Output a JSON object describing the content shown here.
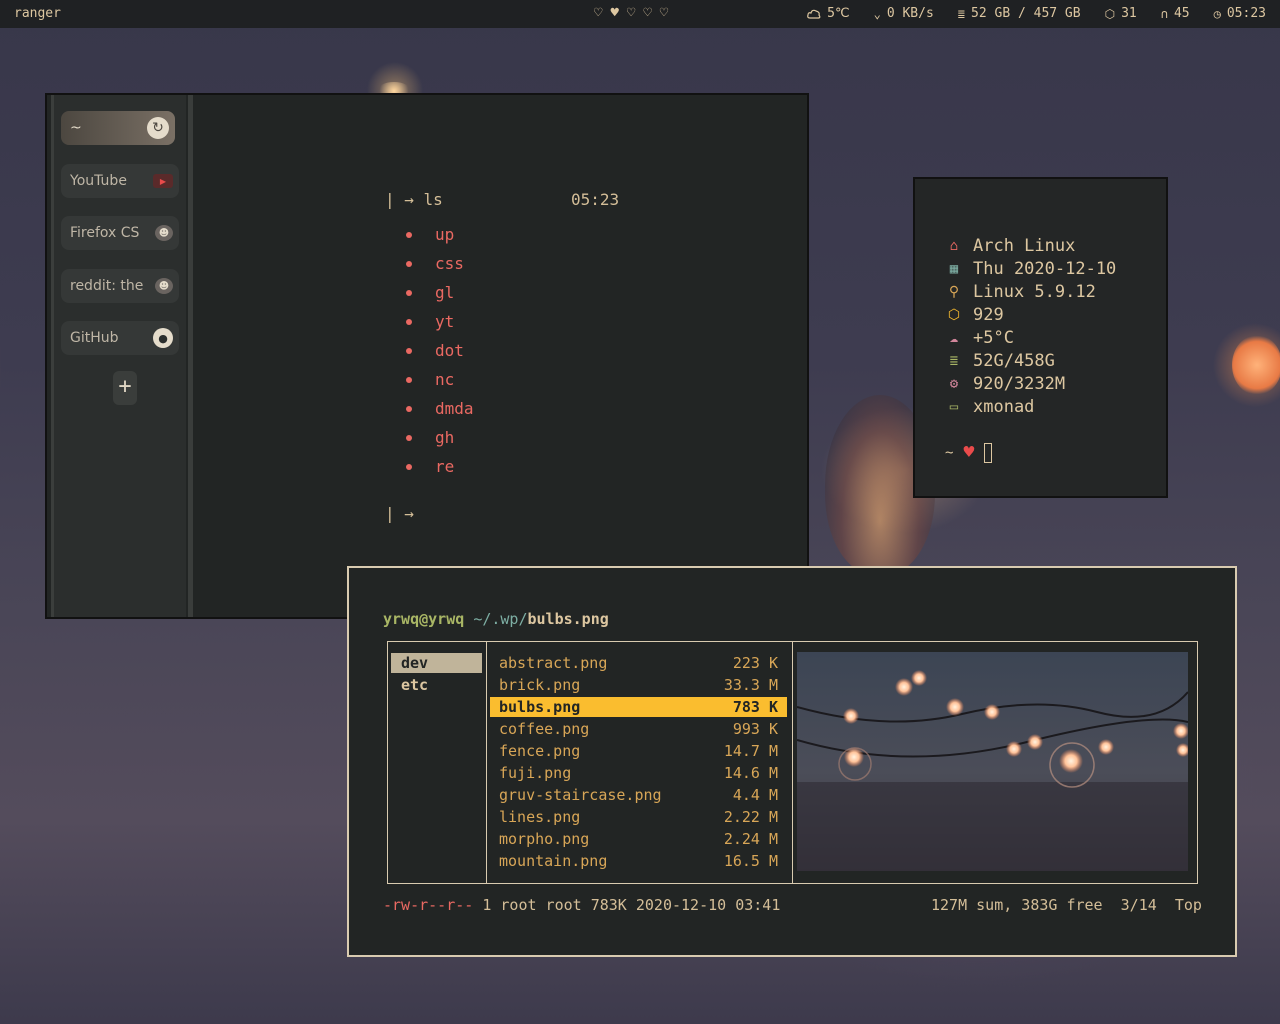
{
  "topbar": {
    "title": "ranger",
    "hearts": [
      "♡",
      "♥",
      "♡",
      "♡",
      "♡"
    ],
    "weather": "5℃",
    "net": "0 KB/s",
    "disk": "52 GB / 457 GB",
    "packages": "31",
    "volume": "45",
    "clock": "05:23"
  },
  "browser": {
    "tabs": [
      {
        "label": "~",
        "icon": "firefox-icon"
      },
      {
        "label": "YouTube",
        "icon": "youtube-icon"
      },
      {
        "label": "Firefox CS",
        "icon": "reddit-icon"
      },
      {
        "label": "reddit: the",
        "icon": "reddit-icon"
      },
      {
        "label": "GitHub",
        "icon": "github-icon"
      }
    ],
    "new_tab": "+",
    "prompt_cmd": "| → ls",
    "prompt_time": "05:23",
    "links": [
      "up",
      "css",
      "gl",
      "yt",
      "dot",
      "nc",
      "dmda",
      "gh",
      "re"
    ],
    "prompt_end": "| →"
  },
  "fetch": {
    "os": "Arch Linux",
    "date": "Thu 2020-12-10",
    "kernel": "Linux 5.9.12",
    "packages": "929",
    "temp": "+5°C",
    "disk": "52G/458G",
    "memory": "920/3232M",
    "wm": "xmonad",
    "prompt": "~"
  },
  "ranger": {
    "user": "yrwq@yrwq",
    "path": "~/.wp/",
    "file": "bulbs.png",
    "parent_dirs": [
      "dev",
      "etc"
    ],
    "files": [
      {
        "name": "abstract.png",
        "size": "223 K"
      },
      {
        "name": "brick.png",
        "size": "33.3 M"
      },
      {
        "name": "bulbs.png",
        "size": "783 K"
      },
      {
        "name": "coffee.png",
        "size": "993 K"
      },
      {
        "name": "fence.png",
        "size": "14.7 M"
      },
      {
        "name": "fuji.png",
        "size": "14.6 M"
      },
      {
        "name": "gruv-staircase.png",
        "size": "4.4 M"
      },
      {
        "name": "lines.png",
        "size": "2.22 M"
      },
      {
        "name": "morpho.png",
        "size": "2.24 M"
      },
      {
        "name": "mountain.png",
        "size": "16.5 M"
      }
    ],
    "selected_index": 2,
    "perms": "-rw-r--r--",
    "info": "1 root root 783K 2020-12-10 03:41",
    "summary": "127M sum, 383G free",
    "position": "3/14",
    "scroll": "Top"
  },
  "colors": {
    "accent": "#fabd2f",
    "fg": "#d4be98",
    "red": "#ea6962",
    "green": "#a9b665",
    "blue": "#7daea3",
    "border": "#d9cbb0"
  }
}
